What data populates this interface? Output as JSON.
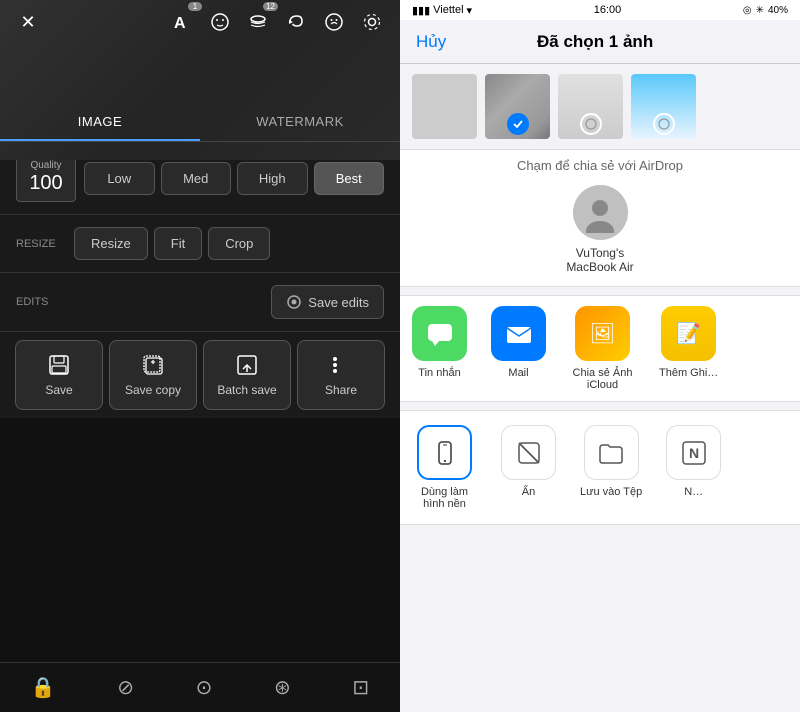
{
  "left": {
    "tabs": [
      {
        "label": "IMAGE",
        "active": true
      },
      {
        "label": "WATERMARK",
        "active": false
      }
    ],
    "quality": {
      "label": "Quality",
      "value": "100",
      "buttons": [
        {
          "label": "Low",
          "active": false
        },
        {
          "label": "Med",
          "active": false
        },
        {
          "label": "High",
          "active": false
        },
        {
          "label": "Best",
          "active": true
        }
      ]
    },
    "resize": {
      "label": "RESIZE",
      "buttons": [
        {
          "label": "Resize"
        },
        {
          "label": "Fit"
        },
        {
          "label": "Crop"
        }
      ]
    },
    "edits": {
      "label": "EDITS",
      "saveButton": "Save edits"
    },
    "actions": [
      {
        "label": "Save",
        "icon": "save"
      },
      {
        "label": "Save copy",
        "icon": "save-copy"
      },
      {
        "label": "Batch save",
        "icon": "batch-save"
      },
      {
        "label": "Share",
        "icon": "share"
      }
    ]
  },
  "right": {
    "statusBar": {
      "carrier": "Viettel",
      "time": "16:00",
      "battery": "40%"
    },
    "header": {
      "cancel": "Hủy",
      "title": "Đã chọn 1 ảnh"
    },
    "airdrop": {
      "label": "Chạm để chia sẻ với AirDrop",
      "device": {
        "name": "VuTong's MacBook Air"
      }
    },
    "apps": [
      {
        "label": "Tin nhắn",
        "color": "#4cd964",
        "icon": "💬"
      },
      {
        "label": "Mail",
        "color": "#007aff",
        "icon": "✉️"
      },
      {
        "label": "Chia sẻ Ảnh iCloud",
        "color": "#ff9500",
        "icon": "🖼"
      },
      {
        "label": "Thêm Ghi…",
        "color": "#ffcc00",
        "icon": "📝"
      }
    ],
    "actions2": [
      {
        "label": "Dùng làm hình nền",
        "active": true,
        "icon": "phone"
      },
      {
        "label": "Ẩn",
        "active": false,
        "icon": "slash"
      },
      {
        "label": "Lưu vào Tệp",
        "active": false,
        "icon": "folder"
      },
      {
        "label": "N…",
        "active": false,
        "icon": "n"
      }
    ]
  }
}
